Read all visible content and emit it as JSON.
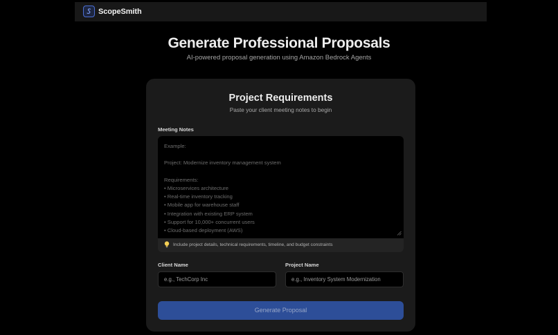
{
  "header": {
    "brand": "ScopeSmith"
  },
  "hero": {
    "title": "Generate Professional Proposals",
    "subtitle": "AI-powered proposal generation using Amazon Bedrock Agents"
  },
  "card": {
    "title": "Project Requirements",
    "subtitle": "Paste your client meeting notes to begin"
  },
  "notes": {
    "label": "Meeting Notes",
    "placeholder_lines": [
      "Example:",
      "",
      "Project: Modernize inventory management system",
      "",
      "Requirements:",
      "• Microservices architecture",
      "• Real-time inventory tracking",
      "• Mobile app for warehouse staff",
      "• Integration with existing ERP system",
      "• Support for 10,000+ concurrent users",
      "• Cloud-based deployment (AWS)"
    ],
    "hint": "Include project details, technical requirements, timeline, and budget constraints",
    "hint_icon": "lightbulb-icon"
  },
  "client": {
    "label": "Client Name",
    "placeholder": "e.g., TechCorp Inc"
  },
  "project": {
    "label": "Project Name",
    "placeholder": "e.g., Inventory System Modernization"
  },
  "submit": {
    "label": "Generate Proposal"
  },
  "colors": {
    "accent": "#2d4e98",
    "background": "#000000",
    "card": "#1b1b1b"
  }
}
